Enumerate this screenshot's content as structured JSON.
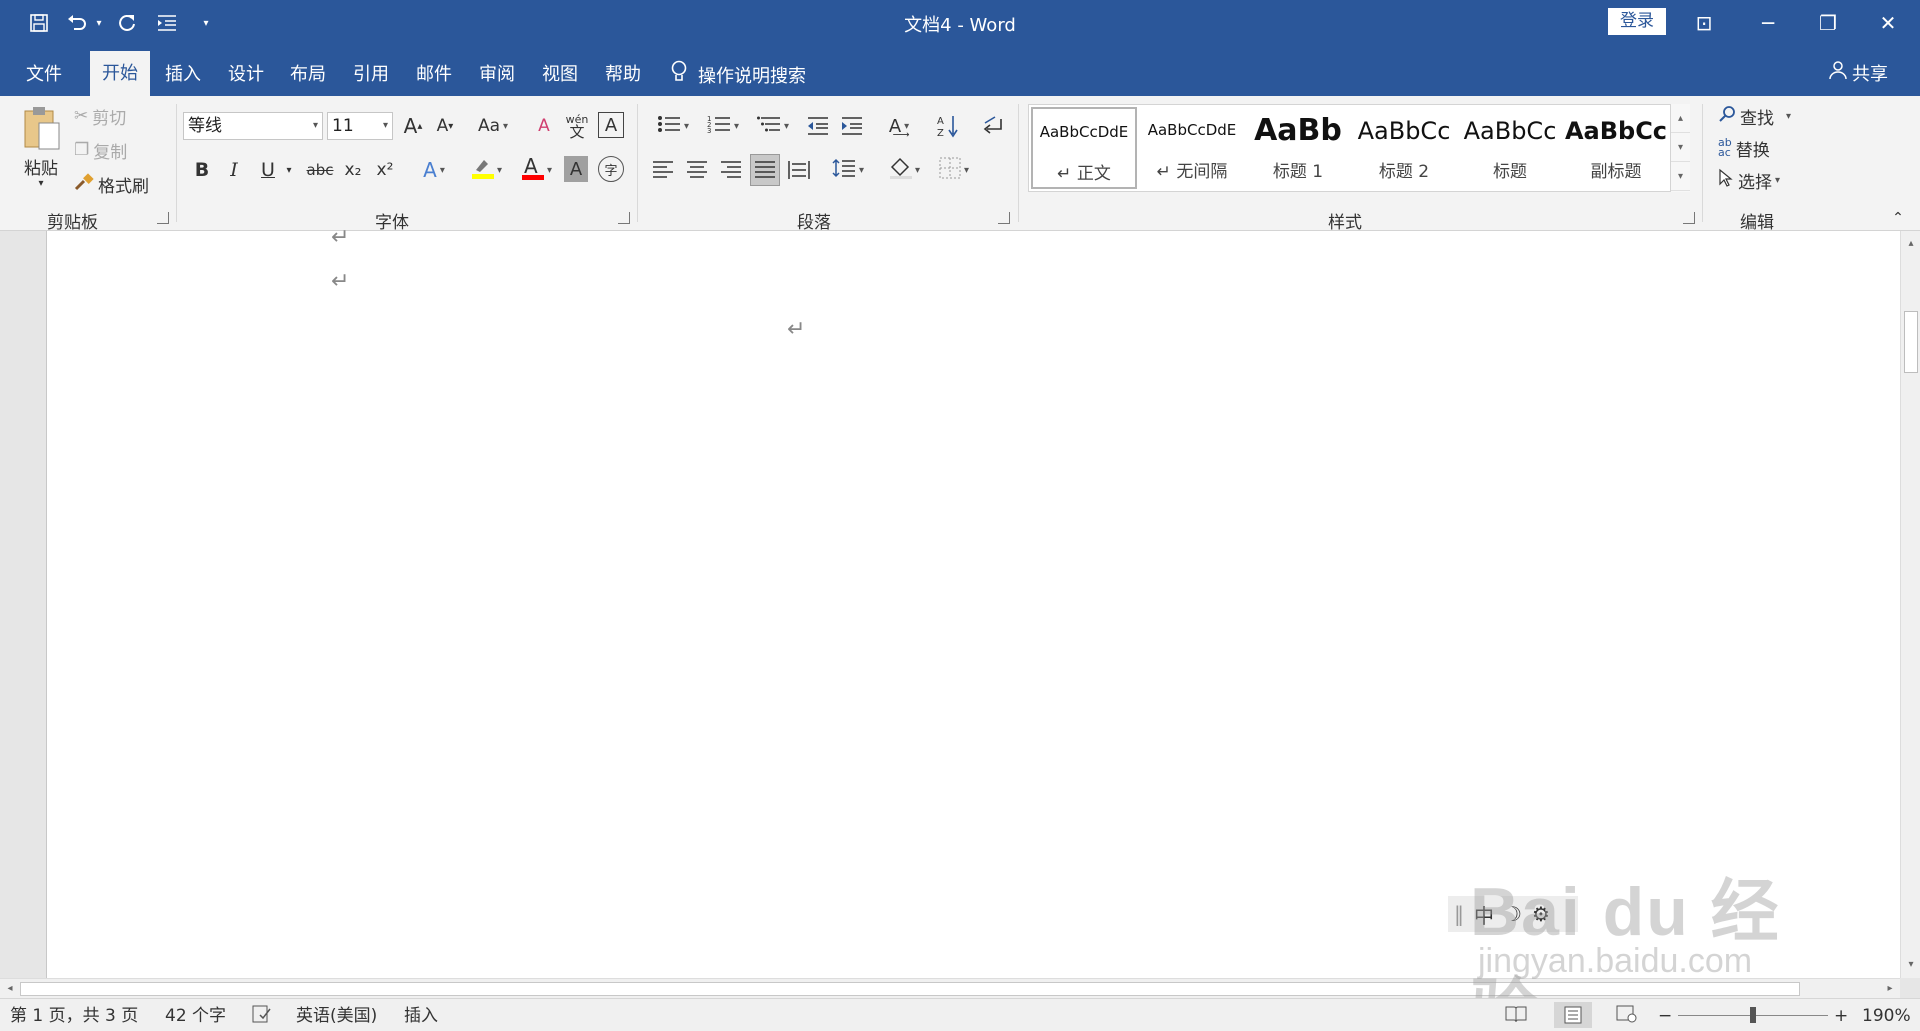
{
  "titlebar": {
    "title": "文档4  -  Word",
    "login": "登录",
    "qat": {
      "save_icon": "save-icon",
      "undo_icon": "undo-icon",
      "redo_icon": "repeat-icon",
      "indent_icon": "indent-icon"
    },
    "controls": {
      "minimize": "─",
      "restore": "❐",
      "close": "✕",
      "ribbon_display": "⊡"
    }
  },
  "tabs": [
    "文件",
    "开始",
    "插入",
    "设计",
    "布局",
    "引用",
    "邮件",
    "审阅",
    "视图",
    "帮助"
  ],
  "tell_me": "操作说明搜索",
  "share": "共享",
  "ribbon": {
    "clipboard": {
      "label": "剪贴板",
      "paste": "粘贴",
      "cut": "剪切",
      "copy": "复制",
      "format_painter": "格式刷"
    },
    "font": {
      "label": "字体",
      "name": "等线",
      "size": "11",
      "aa": "Aa",
      "phonetic": "wén\n文",
      "bold": "B",
      "italic": "I",
      "underline": "U",
      "strike": "abc",
      "sub": "x₂",
      "sup": "x²"
    },
    "paragraph": {
      "label": "段落"
    },
    "styles": {
      "label": "样式",
      "items": [
        {
          "sample": "AaBbCcDdE",
          "name": "↵ 正文"
        },
        {
          "sample": "AaBbCcDdE",
          "name": "↵ 无间隔"
        },
        {
          "sample": "AaBb",
          "name": "标题 1"
        },
        {
          "sample": "AaBbCc",
          "name": "标题 2"
        },
        {
          "sample": "AaBbCc",
          "name": "标题"
        },
        {
          "sample": "AaBbCc",
          "name": "副标题"
        }
      ]
    },
    "editing": {
      "label": "编辑",
      "find": "查找",
      "replace": "替换",
      "select": "选择"
    }
  },
  "document": {
    "pilcrow": "↵"
  },
  "ime": {
    "lang": "中"
  },
  "watermark": {
    "brand": "Bai du 经验",
    "url": "jingyan.baidu.com"
  },
  "status": {
    "page": "第 1 页，共 3 页",
    "words": "42 个字",
    "language": "英语(美国)",
    "mode": "插入",
    "zoom": "190%",
    "zoom_level": 0.5
  },
  "colors": {
    "accent": "#2b579a",
    "highlight": "#ffff00",
    "font_color": "#ff0000"
  }
}
